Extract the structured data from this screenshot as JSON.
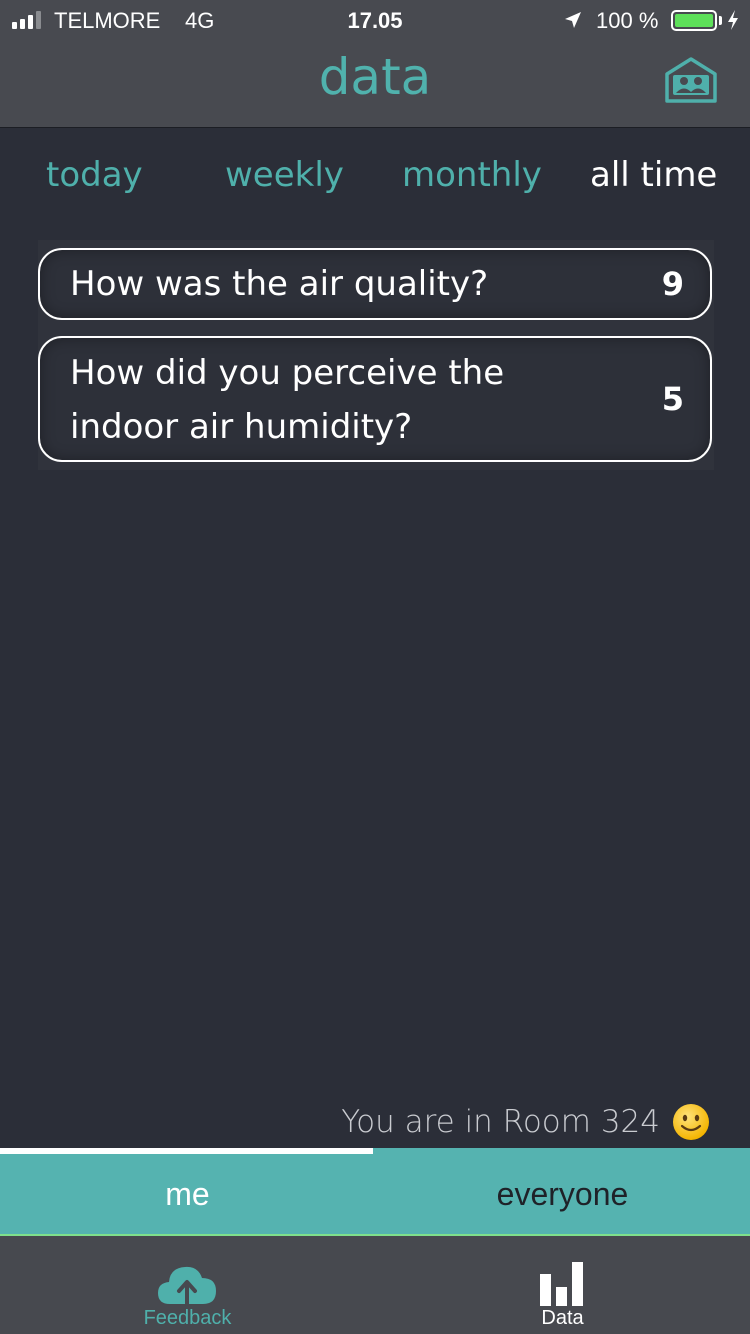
{
  "status_bar": {
    "carrier": "TELMORE",
    "network": "4G",
    "time": "17.05",
    "battery": "100 %",
    "battery_level": 1.0
  },
  "header": {
    "title": "data",
    "room_icon": "room-people-icon"
  },
  "periods": [
    {
      "label": "today",
      "active": false
    },
    {
      "label": "weekly",
      "active": false
    },
    {
      "label": "monthly",
      "active": false
    },
    {
      "label": "all time",
      "active": true
    }
  ],
  "questions": [
    {
      "text": "How was the air quality?",
      "value": "9"
    },
    {
      "text": "How did you perceive the indoor air humidity?",
      "value": "5"
    }
  ],
  "room_info": {
    "text": "You are in Room 324",
    "emoji": "slightly-smiling-face"
  },
  "scope": {
    "me": "me",
    "everyone": "everyone",
    "selected": "me"
  },
  "tabbar": {
    "feedback_label": "Feedback",
    "feedback_icon": "cloud-upload-icon",
    "data_label": "Data",
    "data_icon": "bar-chart-icon",
    "selected": "Data"
  },
  "colors": {
    "accent": "#4fb0ab",
    "segment_bg": "#55b3b0",
    "background": "#2b2e38",
    "header_bg": "#484a50",
    "battery": "#5ee05a"
  }
}
